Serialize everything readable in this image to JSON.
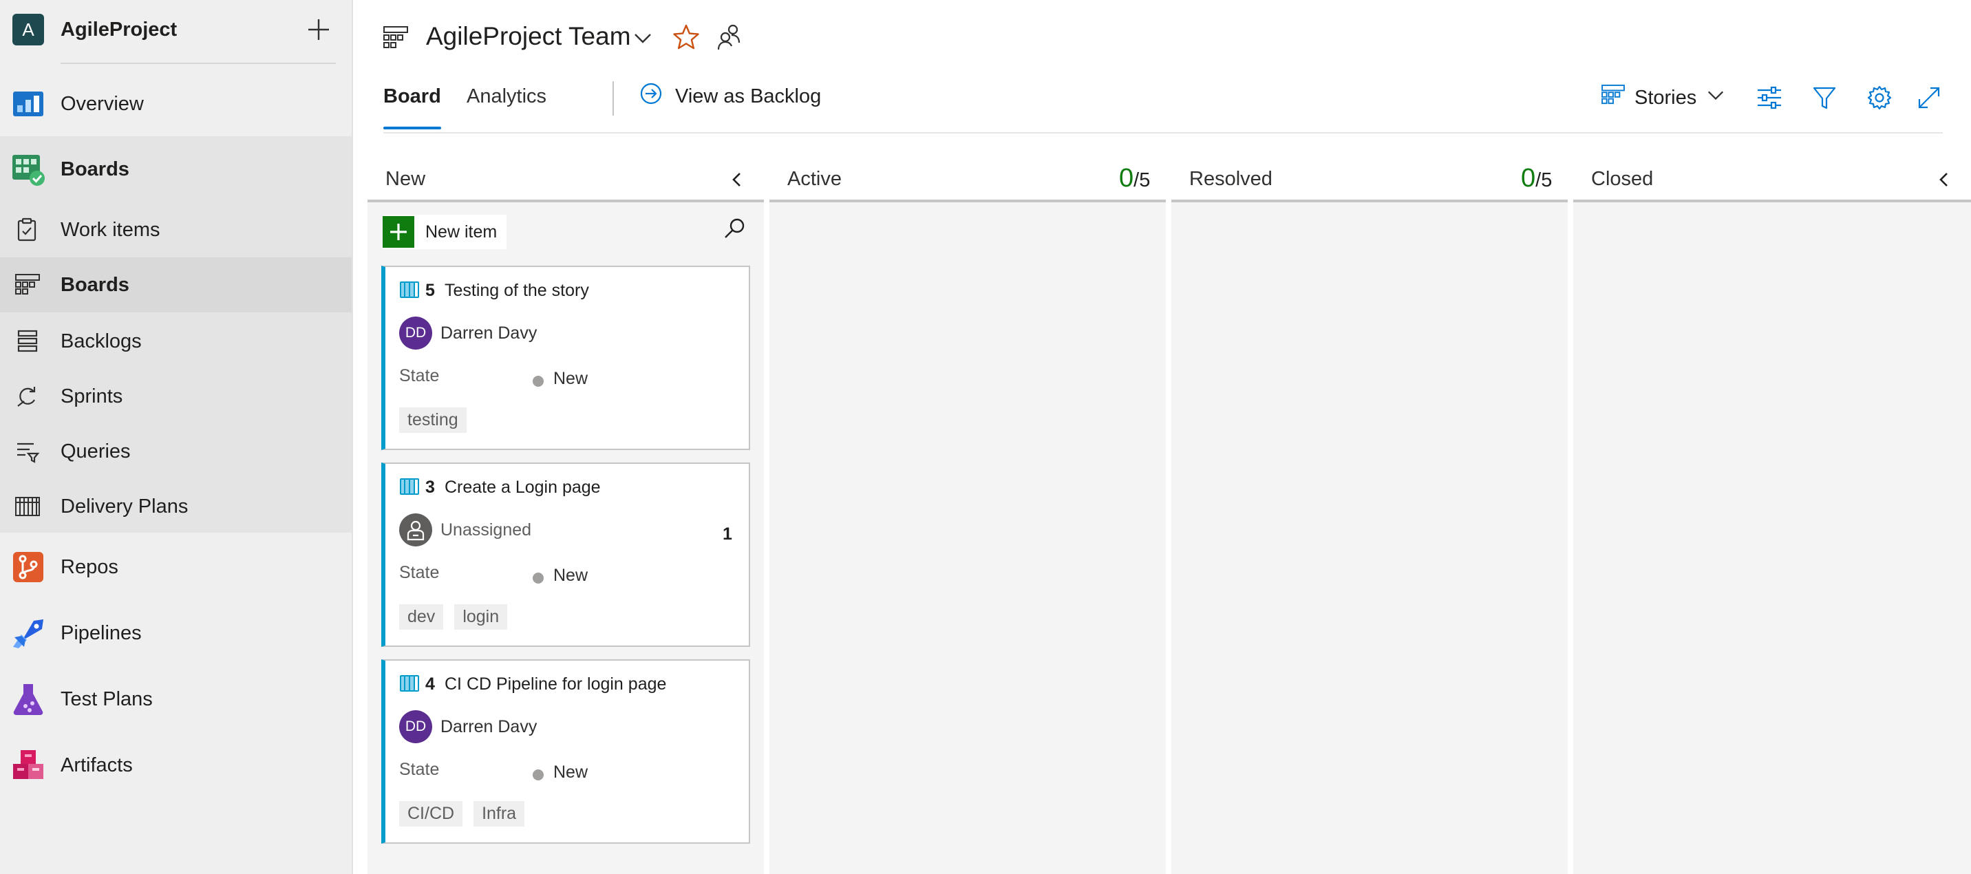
{
  "project": {
    "avatar_letter": "A",
    "name": "AgileProject"
  },
  "nav": {
    "overview": "Overview",
    "boards": "Boards",
    "work_items": "Work items",
    "boards_sub": "Boards",
    "backlogs": "Backlogs",
    "sprints": "Sprints",
    "queries": "Queries",
    "delivery_plans": "Delivery Plans",
    "repos": "Repos",
    "pipelines": "Pipelines",
    "test_plans": "Test Plans",
    "artifacts": "Artifacts"
  },
  "header": {
    "team_name": "AgileProject Team"
  },
  "tabs": {
    "board": "Board",
    "analytics": "Analytics",
    "view_as_backlog": "View as Backlog"
  },
  "toolbar": {
    "backlog_level": "Stories"
  },
  "columns": [
    {
      "name": "New"
    },
    {
      "name": "Active",
      "count": "0",
      "limit": "/5"
    },
    {
      "name": "Resolved",
      "count": "0",
      "limit": "/5"
    },
    {
      "name": "Closed"
    }
  ],
  "new_item_label": "New item",
  "cards": [
    {
      "id": "5",
      "title": "Testing of the story",
      "assignee_initials": "DD",
      "assignee": "Darren Davy",
      "state_label": "State",
      "state": "New",
      "tags": [
        "testing"
      ]
    },
    {
      "id": "3",
      "title": "Create a Login page",
      "assignee": "Unassigned",
      "state_label": "State",
      "state": "New",
      "tags": [
        "dev",
        "login"
      ],
      "badge": "1"
    },
    {
      "id": "4",
      "title": "CI CD Pipeline for login page",
      "assignee_initials": "DD",
      "assignee": "Darren Davy",
      "state_label": "State",
      "state": "New",
      "tags": [
        "CI/CD",
        "Infra"
      ]
    }
  ],
  "colors": {
    "accent": "#0078d4",
    "new_item_green": "#107c10",
    "card_stripe": "#009ccc",
    "avatar_purple": "#5c2d91",
    "star": "#ca5010"
  }
}
